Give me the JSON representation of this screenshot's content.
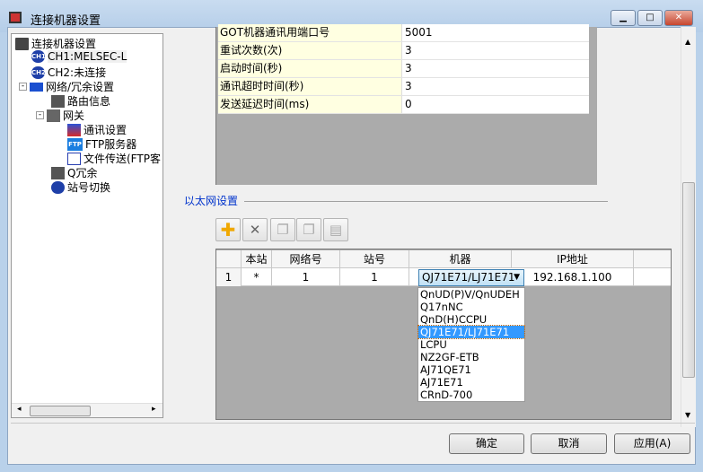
{
  "window": {
    "title": "连接机器设置",
    "min_icon": "minimize-icon",
    "max_icon": "maximize-icon",
    "close_icon": "close-icon"
  },
  "tree": {
    "items": [
      {
        "label": "连接机器设置",
        "icon": "settings-icon"
      },
      {
        "label": "CH1:MELSEC-L",
        "icon": "ch1-icon",
        "badge": "CH1"
      },
      {
        "label": "CH2:未连接",
        "icon": "ch2-icon",
        "badge": "CH2"
      },
      {
        "label": "网络/冗余设置",
        "icon": "network-icon"
      },
      {
        "label": "路由信息",
        "icon": "routing-icon"
      },
      {
        "label": "网关",
        "icon": "gateway-icon"
      },
      {
        "label": "通讯设置",
        "icon": "comm-settings-icon"
      },
      {
        "label": "FTP服务器",
        "icon": "ftp-icon",
        "badge": "FTP"
      },
      {
        "label": "文件传送(FTP客",
        "icon": "file-transfer-icon"
      },
      {
        "label": "Q冗余",
        "icon": "redundancy-icon"
      },
      {
        "label": "站号切换",
        "icon": "station-switch-icon"
      }
    ]
  },
  "properties": [
    {
      "label": "GOT机器通讯用端口号",
      "value": "5001"
    },
    {
      "label": "重试次数(次)",
      "value": "3"
    },
    {
      "label": "启动时间(秒)",
      "value": "3"
    },
    {
      "label": "通讯超时时间(秒)",
      "value": "3"
    },
    {
      "label": "发送延迟时间(ms)",
      "value": "0"
    }
  ],
  "ethernet": {
    "section_title": "以太网设置",
    "toolbar": [
      "add-icon",
      "delete-icon",
      "copy-icon",
      "copy-row-icon",
      "paste-icon"
    ],
    "columns": [
      "",
      "本站",
      "网络号",
      "站号",
      "机器",
      "IP地址"
    ],
    "rows": [
      {
        "num": "1",
        "local": "*",
        "network": "1",
        "station": "1",
        "device": "QJ71E71/LJ71E71",
        "ip": "192.168.1.100"
      }
    ],
    "device_options": [
      "QnUD(P)V/QnUDEH",
      "Q17nNC",
      "QnD(H)CCPU",
      "QJ71E71/LJ71E71",
      "LCPU",
      "NZ2GF-ETB",
      "AJ71QE71",
      "AJ71E71",
      "CRnD-700"
    ],
    "selected_option": "QJ71E71/LJ71E71"
  },
  "buttons": {
    "ok": "确定",
    "cancel": "取消",
    "apply": "应用(A)"
  }
}
